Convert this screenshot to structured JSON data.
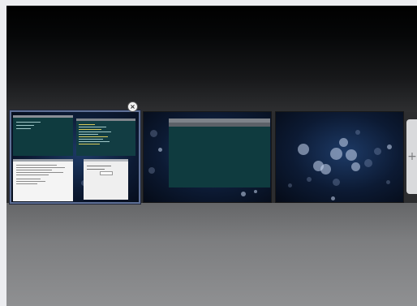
{
  "workspace_switcher": {
    "desktops": [
      {
        "label": "",
        "active": true
      },
      {
        "label": "",
        "active": false
      },
      {
        "label": "",
        "active": false
      }
    ],
    "close_glyph": "×",
    "add_glyph": "+"
  },
  "icons": {
    "close": "close-icon",
    "add": "plus-icon"
  },
  "colors": {
    "wallpaper": "#0c1a33",
    "terminal": "#0f3b3f",
    "active_outline": "#5d6f96"
  }
}
